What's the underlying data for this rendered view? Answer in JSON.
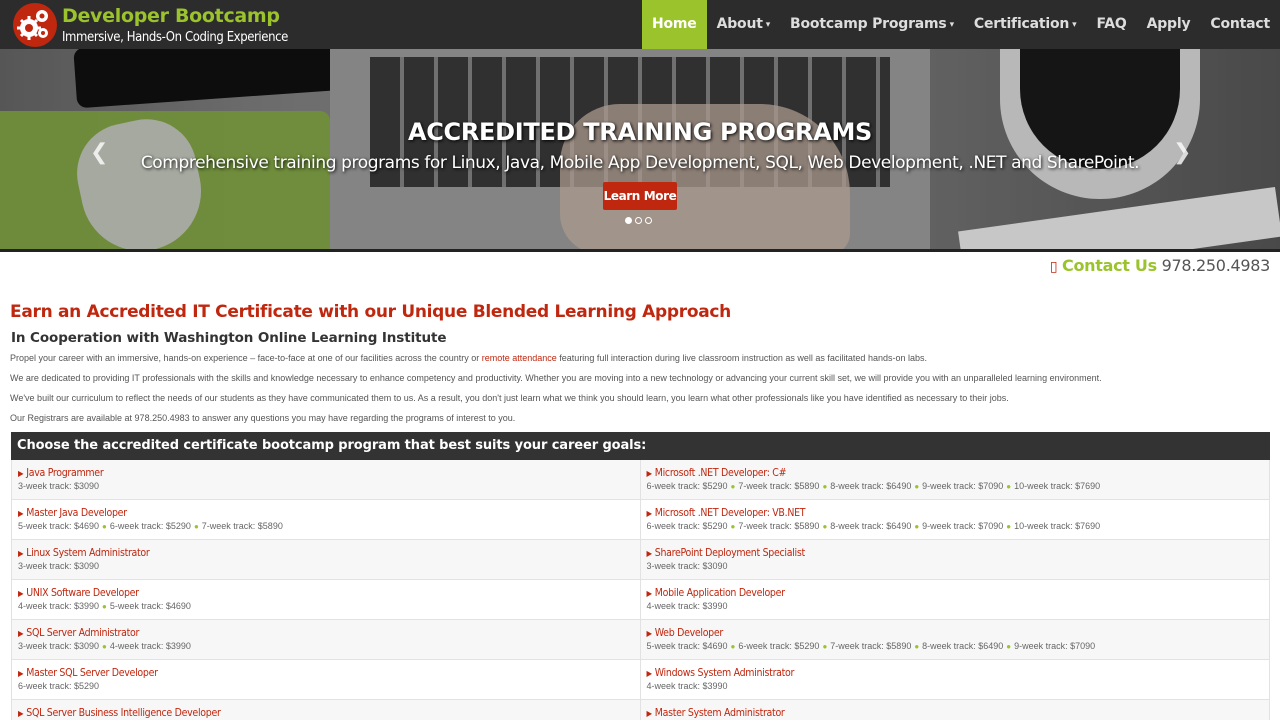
{
  "brand": {
    "name": "Developer Bootcamp",
    "tagline": "Immersive, Hands-On Coding Experience"
  },
  "nav": [
    {
      "label": "Home",
      "active": true,
      "caret": false
    },
    {
      "label": "About",
      "caret": true
    },
    {
      "label": "Bootcamp Programs",
      "caret": true
    },
    {
      "label": "Certification",
      "caret": true
    },
    {
      "label": "FAQ",
      "caret": false
    },
    {
      "label": "Apply",
      "caret": false
    },
    {
      "label": "Contact",
      "caret": false
    }
  ],
  "hero": {
    "title": "ACCREDITED TRAINING PROGRAMS",
    "subtitle": "Comprehensive training programs for Linux, Java, Mobile App Development, SQL, Web Development, .NET and SharePoint.",
    "button": "Learn More",
    "slide_count": 3,
    "active_slide": 1
  },
  "contact": {
    "label": "Contact Us",
    "phone": "978.250.4983"
  },
  "content": {
    "heading": "Earn an Accredited IT Certificate with our Unique Blended Learning Approach",
    "subheading": "In Cooperation with Washington Online Learning Institute",
    "p1_before": "Propel your career with an immersive, hands-on experience – face-to-face at one of our facilities across the country or ",
    "p1_link": "remote attendance",
    "p1_after": " featuring full interaction during live classroom instruction as well as facilitated hands-on labs.",
    "p2": "We are dedicated to providing IT professionals with the skills and knowledge necessary to enhance competency and productivity. Whether you are moving into a new technology or advancing your current skill set, we will provide you with an unparalleled learning environment.",
    "p3": "We've built our curriculum to reflect the needs of our students as they have communicated them to us. As a result, you don't just learn what we think you should learn, you learn what other professionals like you have identified as necessary to their jobs.",
    "p4": "Our Registrars are available at 978.250.4983 to answer any questions you may have regarding the programs of interest to you."
  },
  "programs": {
    "header": "Choose the accredited certificate bootcamp program that best suits your career goals:",
    "rows": [
      [
        {
          "name": "Java Programmer",
          "tracks": [
            "3-week track: $3090"
          ]
        },
        {
          "name": "Microsoft .NET Developer: C#",
          "tracks": [
            "6-week track: $5290",
            "7-week track: $5890",
            "8-week track: $6490",
            "9-week track: $7090",
            "10-week track: $7690"
          ]
        }
      ],
      [
        {
          "name": "Master Java Developer",
          "tracks": [
            "5-week track: $4690",
            "6-week track: $5290",
            "7-week track: $5890"
          ]
        },
        {
          "name": "Microsoft .NET Developer: VB.NET",
          "tracks": [
            "6-week track: $5290",
            "7-week track: $5890",
            "8-week track: $6490",
            "9-week track: $7090",
            "10-week track: $7690"
          ]
        }
      ],
      [
        {
          "name": "Linux System Administrator",
          "tracks": [
            "3-week track: $3090"
          ]
        },
        {
          "name": "SharePoint Deployment Specialist",
          "tracks": [
            "3-week track: $3090"
          ]
        }
      ],
      [
        {
          "name": "UNIX Software Developer",
          "tracks": [
            "4-week track: $3990",
            "5-week track: $4690"
          ]
        },
        {
          "name": "Mobile Application Developer",
          "tracks": [
            "4-week track: $3990"
          ]
        }
      ],
      [
        {
          "name": "SQL Server Administrator",
          "tracks": [
            "3-week track: $3090",
            "4-week track: $3990"
          ]
        },
        {
          "name": "Web Developer",
          "tracks": [
            "5-week track: $4690",
            "6-week track: $5290",
            "7-week track: $5890",
            "8-week track: $6490",
            "9-week track: $7090"
          ]
        }
      ],
      [
        {
          "name": "Master SQL Server Developer",
          "tracks": [
            "6-week track: $5290"
          ]
        },
        {
          "name": "Windows System Administrator",
          "tracks": [
            "4-week track: $3990"
          ]
        }
      ],
      [
        {
          "name": "SQL Server Business Intelligence Developer",
          "tracks": []
        },
        {
          "name": "Master System Administrator",
          "tracks": []
        }
      ]
    ]
  }
}
